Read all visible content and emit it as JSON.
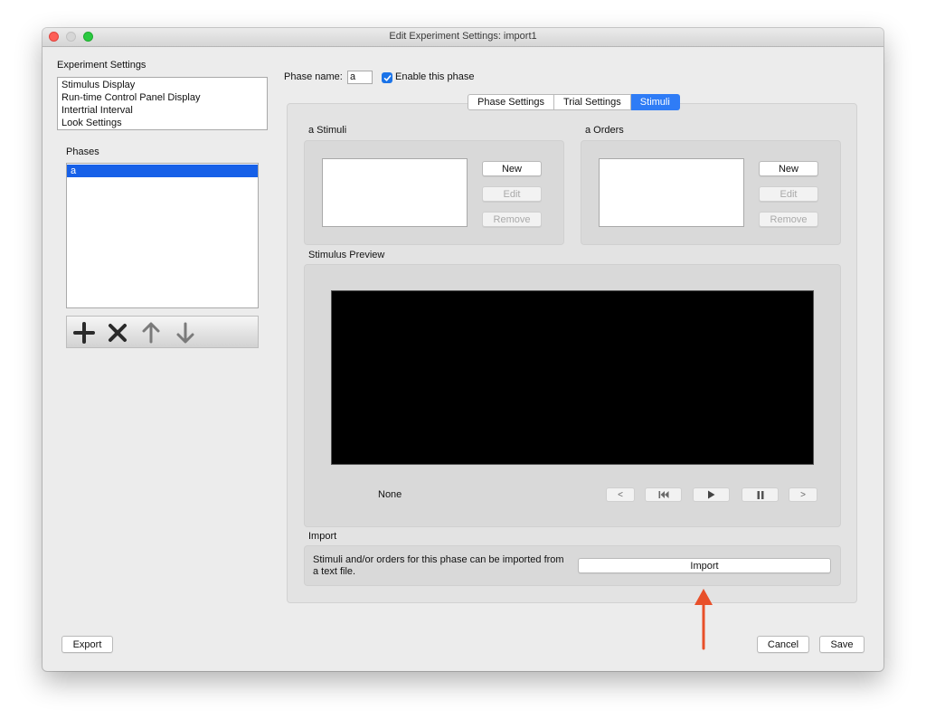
{
  "window": {
    "title": "Edit Experiment Settings: import1"
  },
  "experiment_settings": {
    "label": "Experiment Settings",
    "items": [
      "Stimulus Display",
      "Run-time Control Panel Display",
      "Intertrial Interval",
      "Look Settings"
    ]
  },
  "phases": {
    "label": "Phases",
    "items": [
      {
        "label": "a",
        "selected": true
      }
    ],
    "toolbar_icons": [
      "plus-icon",
      "x-icon",
      "arrow-up-icon",
      "arrow-down-icon"
    ]
  },
  "phase": {
    "name_label": "Phase name:",
    "name_value": "a",
    "enable_label": "Enable this phase",
    "enabled": true
  },
  "tabs": [
    {
      "label": "Phase Settings",
      "active": false
    },
    {
      "label": "Trial Settings",
      "active": false
    },
    {
      "label": "Stimuli",
      "active": true
    }
  ],
  "stimuli": {
    "label": "a Stimuli",
    "new_label": "New",
    "edit_label": "Edit",
    "remove_label": "Remove"
  },
  "orders": {
    "label": "a Orders",
    "new_label": "New",
    "edit_label": "Edit",
    "remove_label": "Remove"
  },
  "preview": {
    "label": "Stimulus Preview",
    "current": "None",
    "controls": [
      "<",
      "skip-back-icon",
      "play-icon",
      "pause-icon",
      ">"
    ]
  },
  "import": {
    "label": "Import",
    "description": "Stimuli and/or orders for this phase can be imported from a text file.",
    "button_label": "Import"
  },
  "footer": {
    "export_label": "Export",
    "cancel_label": "Cancel",
    "save_label": "Save"
  },
  "colors": {
    "window_bg": "#ececec",
    "selection": "#1660e8",
    "active_tab": "#2f7cf6",
    "annotation_arrow": "#e8502a"
  }
}
